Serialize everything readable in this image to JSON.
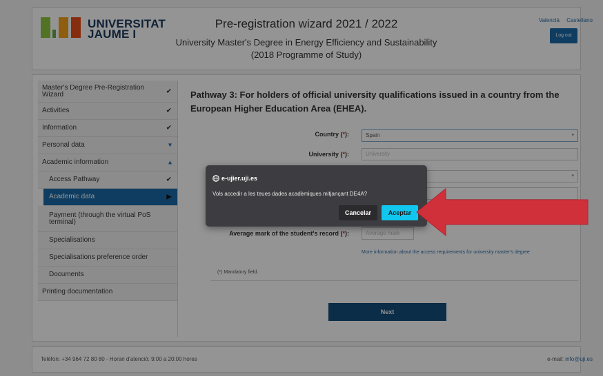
{
  "header": {
    "logo_line1": "UNIVERSITAT",
    "logo_line2": "JAUME I",
    "title": "Pre-registration wizard 2021 / 2022",
    "degree": "University Master's Degree in Energy Efficiency and Sustainability",
    "programme": "(2018 Programme of Study)",
    "lang_valencia": "Valencià",
    "lang_castellano": "Castellano",
    "logout_label": "Log out"
  },
  "sidebar": {
    "items": [
      {
        "label": "Master's Degree Pre-Registration Wizard",
        "icon": "check-icon",
        "sub": false
      },
      {
        "label": "Activities",
        "icon": "check-icon",
        "sub": false
      },
      {
        "label": "Information",
        "icon": "check-icon",
        "sub": false
      },
      {
        "label": "Personal data",
        "icon": "caret-down-icon",
        "sub": false
      },
      {
        "label": "Academic information",
        "icon": "caret-up-icon",
        "sub": false
      },
      {
        "label": "Access Pathway",
        "icon": "check-icon",
        "sub": true
      },
      {
        "label": "Academic data",
        "icon": "play-icon",
        "sub": true,
        "active": true
      },
      {
        "label": "Payment (through the virtual PoS terminal)",
        "icon": "",
        "sub": true
      },
      {
        "label": "Specialisations",
        "icon": "",
        "sub": true
      },
      {
        "label": "Specialisations preference order",
        "icon": "",
        "sub": true
      },
      {
        "label": "Documents",
        "icon": "",
        "sub": true
      },
      {
        "label": "Printing documentation",
        "icon": "",
        "sub": false
      }
    ]
  },
  "content": {
    "pathway_title": "Pathway 3: For holders of official university qualifications issued in a country from the European Higher Education Area (EHEA).",
    "country_label": "Country (",
    "university_label": "University (",
    "avg_mark_label": "Average mark of the student's record (",
    "req_star": "*",
    "close_paren": "):",
    "country_value": "Spain",
    "university_placeholder": "University",
    "avg_mark_placeholder": "Average mark",
    "more_info_link": "More information about the access requirements for university master's degree",
    "mandatory_note": "(*)  Mandatory field.",
    "next_label": "Next"
  },
  "footer": {
    "left": "Telèfon: +34 964 72 80 80 - Horari d'atenció: 9:00 a 20:00 hores",
    "email_prefix": "e-mail: ",
    "email": "info@uji.es"
  },
  "dialog": {
    "site": "e-ujier.uji.es",
    "message": "Vols accedir a les teues dades acadèmiques mitjançant DE4A?",
    "cancel_label": "Cancelar",
    "accept_label": "Aceptar"
  },
  "colors": {
    "accent": "#1a6aa8",
    "accept_button": "#12c7ef",
    "arrow": "#d0303a",
    "next_button": "#144f7a"
  }
}
